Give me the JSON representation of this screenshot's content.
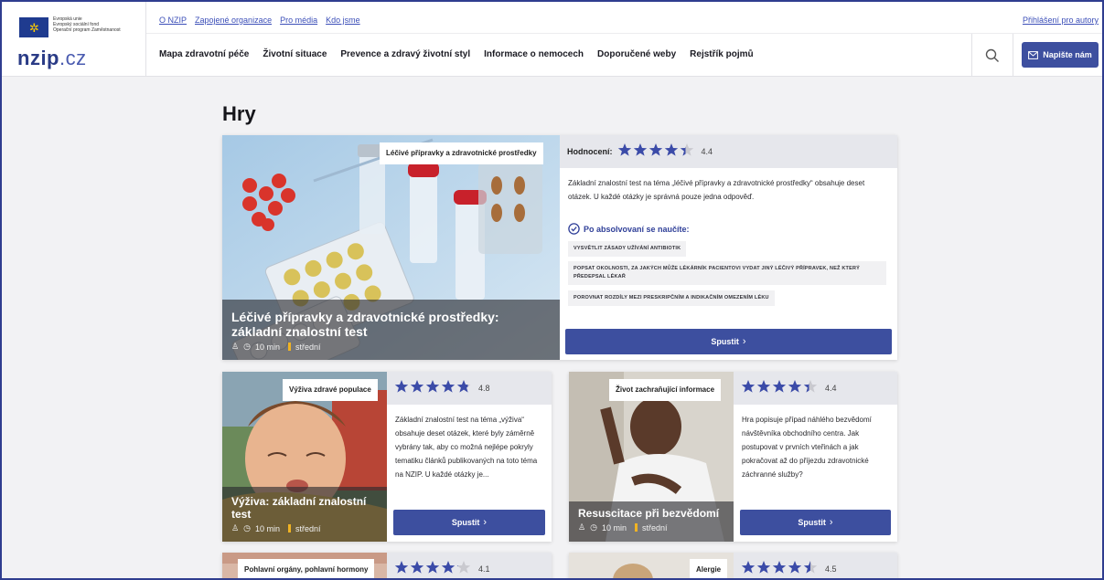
{
  "header": {
    "eu_lines": [
      "Evropská unie",
      "Evropský sociální fond",
      "Operační program Zaměstnanost"
    ],
    "brand_main": "nzip",
    "brand_tld": ".cz",
    "top_links": [
      "O NZIP",
      "Zapojené organizace",
      "Pro média",
      "Kdo jsme"
    ],
    "login": "Přihlášení pro autory",
    "nav": [
      "Mapa zdravotní péče",
      "Životní situace",
      "Prevence a zdravý životní styl",
      "Informace o nemocech",
      "Doporučené weby",
      "Rejstřík pojmů"
    ],
    "cta": "Napište nám"
  },
  "page_title": "Hry",
  "featured": {
    "tag": "Léčivé přípravky a zdravotnické prostředky",
    "title": "Léčivé přípravky a zdravotnické prostředky: základní znalostní test",
    "duration": "10 min",
    "level": "střední",
    "rating_label": "Hodnocení:",
    "rating": 4.4,
    "score": "4.4",
    "description": "Základní znalostní test na téma „léčivé přípravky a zdravotnické prostředky“ obsahuje deset otázek. U každé otázky je správná pouze jedna odpověď.",
    "learn_title": "Po absolvovaní se naučíte:",
    "outcomes": [
      "VYSVĚTLIT ZÁSADY UŽÍVÁNÍ ANTIBIOTIK",
      "POPSAT OKOLNOSTI, ZA JAKÝCH MŮŽE LÉKÁRNÍK PACIENTOVI VYDAT JINÝ LÉČIVÝ PŘÍPRAVEK, NEŽ KTERÝ PŘEDEPSAL LÉKAŘ",
      "POROVNAT ROZDÍLY MEZI PRESKRIPČNÍM A INDIKAČNÍM OMEZENÍM LÉKU"
    ],
    "button": "Spustit"
  },
  "cards": [
    {
      "tag": "Výživa zdravé populace",
      "title": "Výživa: základní znalostní test",
      "duration": "10 min",
      "level": "střední",
      "rating": 4.8,
      "score": "4.8",
      "description": "Základní znalostní test na téma „výživa“ obsahuje deset otázek, které byly záměrně vybrány tak, aby co možná nejlépe pokryly tematiku článků publikovaných na toto téma na NZIP. U každé otázky je...",
      "button": "Spustit"
    },
    {
      "tag": "Život zachraňující informace",
      "title": "Resuscitace při bezvědomí",
      "duration": "10 min",
      "level": "střední",
      "rating": 4.4,
      "score": "4.4",
      "description": "Hra popisuje případ náhlého bezvědomí návštěvníka obchodního centra. Jak postupovat v prvních vteřinách a jak pokračovat až do příjezdu zdravotnické záchranné služby?",
      "button": "Spustit"
    },
    {
      "tag": "Pohlavní orgány, pohlavní hormony",
      "rating": 4.1,
      "score": "4.1"
    },
    {
      "tag": "Alergie",
      "rating": 4.5,
      "score": "4.5"
    }
  ],
  "colors": {
    "accent": "#3d4f9f",
    "star": "#3b4ba8",
    "star_empty": "#c9c9cf",
    "level_bar": "#f0b323"
  }
}
